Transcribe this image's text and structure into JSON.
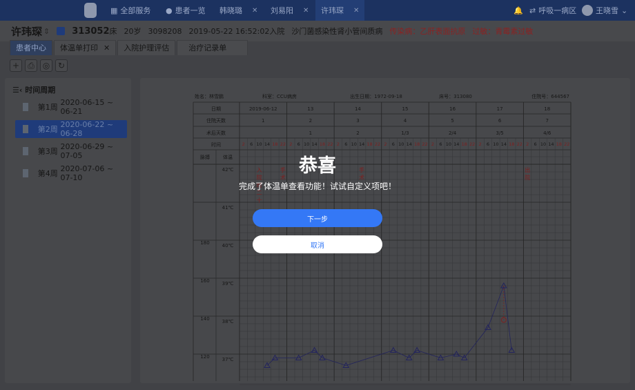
{
  "topbar": {
    "all_services": "全部服务",
    "patients": "患者一览",
    "tabs": [
      {
        "label": "韩晓璐",
        "active": false
      },
      {
        "label": "刘易阳",
        "active": false
      },
      {
        "label": "许玮琛",
        "active": true
      }
    ],
    "ward": "呼吸一病区",
    "user": "王晓雪"
  },
  "patient": {
    "name": "许玮琛",
    "bed": "313052",
    "bed_unit": "床",
    "age": "20岁",
    "id": "3098208",
    "admit": "2019-05-22 16:52:02入院",
    "diagnosis": "沙门菌感染性肾小管间质病",
    "infection": "传染病：乙肝表面抗原",
    "allergy": "过敏：青霉素过敏"
  },
  "tabs": [
    {
      "label": "患者中心",
      "active": true,
      "closable": false
    },
    {
      "label": "体温单打印",
      "active": false,
      "closable": true
    },
    {
      "label": "入院护理评估",
      "active": false,
      "closable": false
    },
    {
      "label": "治疗记录单",
      "active": false,
      "closable": false
    }
  ],
  "toolbar": [
    "plus-icon",
    "print-icon",
    "settings-icon",
    "refresh-icon"
  ],
  "period": {
    "title": "时间周期",
    "weeks": [
      {
        "label": "第1周",
        "range": "2020-06-15 ~ 06-21",
        "selected": false
      },
      {
        "label": "第2周",
        "range": "2020-06-22 ~ 06-28",
        "selected": true
      },
      {
        "label": "第3周",
        "range": "2020-06-29 ~ 07-05",
        "selected": false
      },
      {
        "label": "第4周",
        "range": "2020-07-06 ~ 07-10",
        "selected": false
      }
    ]
  },
  "sheet": {
    "name": "姓名：林雪鹏",
    "dept": "科室：CCU病房",
    "birth": "出生日期：1972-09-18",
    "bed": "床号：313080",
    "inpatient": "住院号：644567",
    "row_labels": [
      "日期",
      "住院天数",
      "术后天数",
      "时间"
    ],
    "dates": [
      "2019-06-12",
      "13",
      "14",
      "15",
      "16",
      "17",
      "18"
    ],
    "hosp_days": [
      "1",
      "2",
      "3",
      "4",
      "5",
      "6",
      "7"
    ],
    "post_op": [
      "",
      "1",
      "2",
      "1/3",
      "2/4",
      "3/5",
      "4/6"
    ],
    "hours": [
      "2",
      "6",
      "10",
      "14",
      "18",
      "22"
    ],
    "pulse_label": "脉搏",
    "temp_label": "体温",
    "temp_ticks": [
      "42℃",
      "41℃",
      "40℃",
      "39℃",
      "38℃",
      "37℃"
    ],
    "pulse_ticks": [
      "",
      "",
      "180",
      "160",
      "140",
      "120"
    ],
    "annotations": [
      {
        "day": 0,
        "hour": 10,
        "text": "入院时二十"
      },
      {
        "day": 0,
        "hour": 22,
        "text": "手术"
      },
      {
        "day": 2,
        "hour": 14,
        "text": "手术"
      },
      {
        "day": 6,
        "hour": 2,
        "text": "出院"
      }
    ],
    "temps": [
      {
        "day": 0,
        "hour": 14,
        "temp": 36.7
      },
      {
        "day": 0,
        "hour": 18,
        "temp": 36.9
      },
      {
        "day": 1,
        "hour": 6,
        "temp": 36.9
      },
      {
        "day": 1,
        "hour": 14,
        "temp": 37.1
      },
      {
        "day": 1,
        "hour": 18,
        "temp": 36.9
      },
      {
        "day": 2,
        "hour": 6,
        "temp": 36.7
      },
      {
        "day": 3,
        "hour": 6,
        "temp": 37.1
      },
      {
        "day": 3,
        "hour": 14,
        "temp": 36.9
      },
      {
        "day": 3,
        "hour": 18,
        "temp": 37.1
      },
      {
        "day": 4,
        "hour": 6,
        "temp": 36.9
      },
      {
        "day": 4,
        "hour": 14,
        "temp": 37.0
      },
      {
        "day": 4,
        "hour": 18,
        "temp": 36.9
      },
      {
        "day": 5,
        "hour": 6,
        "temp": 37.7
      },
      {
        "day": 5,
        "hour": 14,
        "temp": 38.8
      },
      {
        "day": 5,
        "hour": 18,
        "temp": 37.1
      }
    ],
    "cooled": {
      "day": 5,
      "hour": 14,
      "temp": 37.9
    },
    "colors": {
      "line": "#3a3aa8",
      "red": "#c83030"
    }
  },
  "modal": {
    "title": "恭喜",
    "message": "完成了体温单查看功能！试试自定义项吧！",
    "next": "下一步",
    "cancel": "取消"
  }
}
